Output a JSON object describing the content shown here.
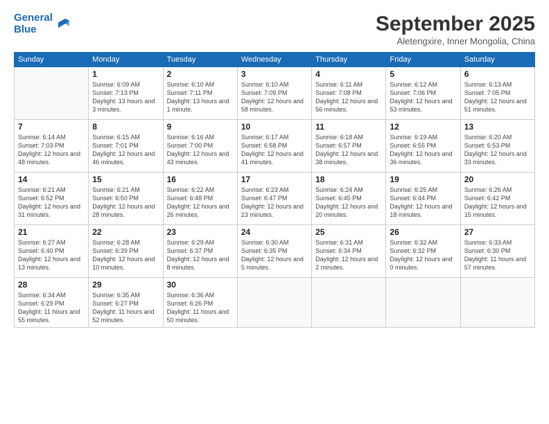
{
  "logo": {
    "line1": "General",
    "line2": "Blue"
  },
  "title": "September 2025",
  "location": "Aletengxire, Inner Mongolia, China",
  "days_of_week": [
    "Sunday",
    "Monday",
    "Tuesday",
    "Wednesday",
    "Thursday",
    "Friday",
    "Saturday"
  ],
  "weeks": [
    [
      {
        "day": "",
        "info": ""
      },
      {
        "day": "1",
        "info": "Sunrise: 6:09 AM\nSunset: 7:13 PM\nDaylight: 13 hours\nand 3 minutes."
      },
      {
        "day": "2",
        "info": "Sunrise: 6:10 AM\nSunset: 7:11 PM\nDaylight: 13 hours\nand 1 minute."
      },
      {
        "day": "3",
        "info": "Sunrise: 6:10 AM\nSunset: 7:09 PM\nDaylight: 12 hours\nand 58 minutes."
      },
      {
        "day": "4",
        "info": "Sunrise: 6:11 AM\nSunset: 7:08 PM\nDaylight: 12 hours\nand 56 minutes."
      },
      {
        "day": "5",
        "info": "Sunrise: 6:12 AM\nSunset: 7:06 PM\nDaylight: 12 hours\nand 53 minutes."
      },
      {
        "day": "6",
        "info": "Sunrise: 6:13 AM\nSunset: 7:05 PM\nDaylight: 12 hours\nand 51 minutes."
      }
    ],
    [
      {
        "day": "7",
        "info": "Sunrise: 6:14 AM\nSunset: 7:03 PM\nDaylight: 12 hours\nand 48 minutes."
      },
      {
        "day": "8",
        "info": "Sunrise: 6:15 AM\nSunset: 7:01 PM\nDaylight: 12 hours\nand 46 minutes."
      },
      {
        "day": "9",
        "info": "Sunrise: 6:16 AM\nSunset: 7:00 PM\nDaylight: 12 hours\nand 43 minutes."
      },
      {
        "day": "10",
        "info": "Sunrise: 6:17 AM\nSunset: 6:58 PM\nDaylight: 12 hours\nand 41 minutes."
      },
      {
        "day": "11",
        "info": "Sunrise: 6:18 AM\nSunset: 6:57 PM\nDaylight: 12 hours\nand 38 minutes."
      },
      {
        "day": "12",
        "info": "Sunrise: 6:19 AM\nSunset: 6:55 PM\nDaylight: 12 hours\nand 36 minutes."
      },
      {
        "day": "13",
        "info": "Sunrise: 6:20 AM\nSunset: 6:53 PM\nDaylight: 12 hours\nand 33 minutes."
      }
    ],
    [
      {
        "day": "14",
        "info": "Sunrise: 6:21 AM\nSunset: 6:52 PM\nDaylight: 12 hours\nand 31 minutes."
      },
      {
        "day": "15",
        "info": "Sunrise: 6:21 AM\nSunset: 6:50 PM\nDaylight: 12 hours\nand 28 minutes."
      },
      {
        "day": "16",
        "info": "Sunrise: 6:22 AM\nSunset: 6:48 PM\nDaylight: 12 hours\nand 26 minutes."
      },
      {
        "day": "17",
        "info": "Sunrise: 6:23 AM\nSunset: 6:47 PM\nDaylight: 12 hours\nand 23 minutes."
      },
      {
        "day": "18",
        "info": "Sunrise: 6:24 AM\nSunset: 6:45 PM\nDaylight: 12 hours\nand 20 minutes."
      },
      {
        "day": "19",
        "info": "Sunrise: 6:25 AM\nSunset: 6:44 PM\nDaylight: 12 hours\nand 18 minutes."
      },
      {
        "day": "20",
        "info": "Sunrise: 6:26 AM\nSunset: 6:42 PM\nDaylight: 12 hours\nand 15 minutes."
      }
    ],
    [
      {
        "day": "21",
        "info": "Sunrise: 6:27 AM\nSunset: 6:40 PM\nDaylight: 12 hours\nand 13 minutes."
      },
      {
        "day": "22",
        "info": "Sunrise: 6:28 AM\nSunset: 6:39 PM\nDaylight: 12 hours\nand 10 minutes."
      },
      {
        "day": "23",
        "info": "Sunrise: 6:29 AM\nSunset: 6:37 PM\nDaylight: 12 hours\nand 8 minutes."
      },
      {
        "day": "24",
        "info": "Sunrise: 6:30 AM\nSunset: 6:35 PM\nDaylight: 12 hours\nand 5 minutes."
      },
      {
        "day": "25",
        "info": "Sunrise: 6:31 AM\nSunset: 6:34 PM\nDaylight: 12 hours\nand 2 minutes."
      },
      {
        "day": "26",
        "info": "Sunrise: 6:32 AM\nSunset: 6:32 PM\nDaylight: 12 hours\nand 0 minutes."
      },
      {
        "day": "27",
        "info": "Sunrise: 6:33 AM\nSunset: 6:30 PM\nDaylight: 11 hours\nand 57 minutes."
      }
    ],
    [
      {
        "day": "28",
        "info": "Sunrise: 6:34 AM\nSunset: 6:29 PM\nDaylight: 11 hours\nand 55 minutes."
      },
      {
        "day": "29",
        "info": "Sunrise: 6:35 AM\nSunset: 6:27 PM\nDaylight: 11 hours\nand 52 minutes."
      },
      {
        "day": "30",
        "info": "Sunrise: 6:36 AM\nSunset: 6:26 PM\nDaylight: 11 hours\nand 50 minutes."
      },
      {
        "day": "",
        "info": ""
      },
      {
        "day": "",
        "info": ""
      },
      {
        "day": "",
        "info": ""
      },
      {
        "day": "",
        "info": ""
      }
    ]
  ]
}
